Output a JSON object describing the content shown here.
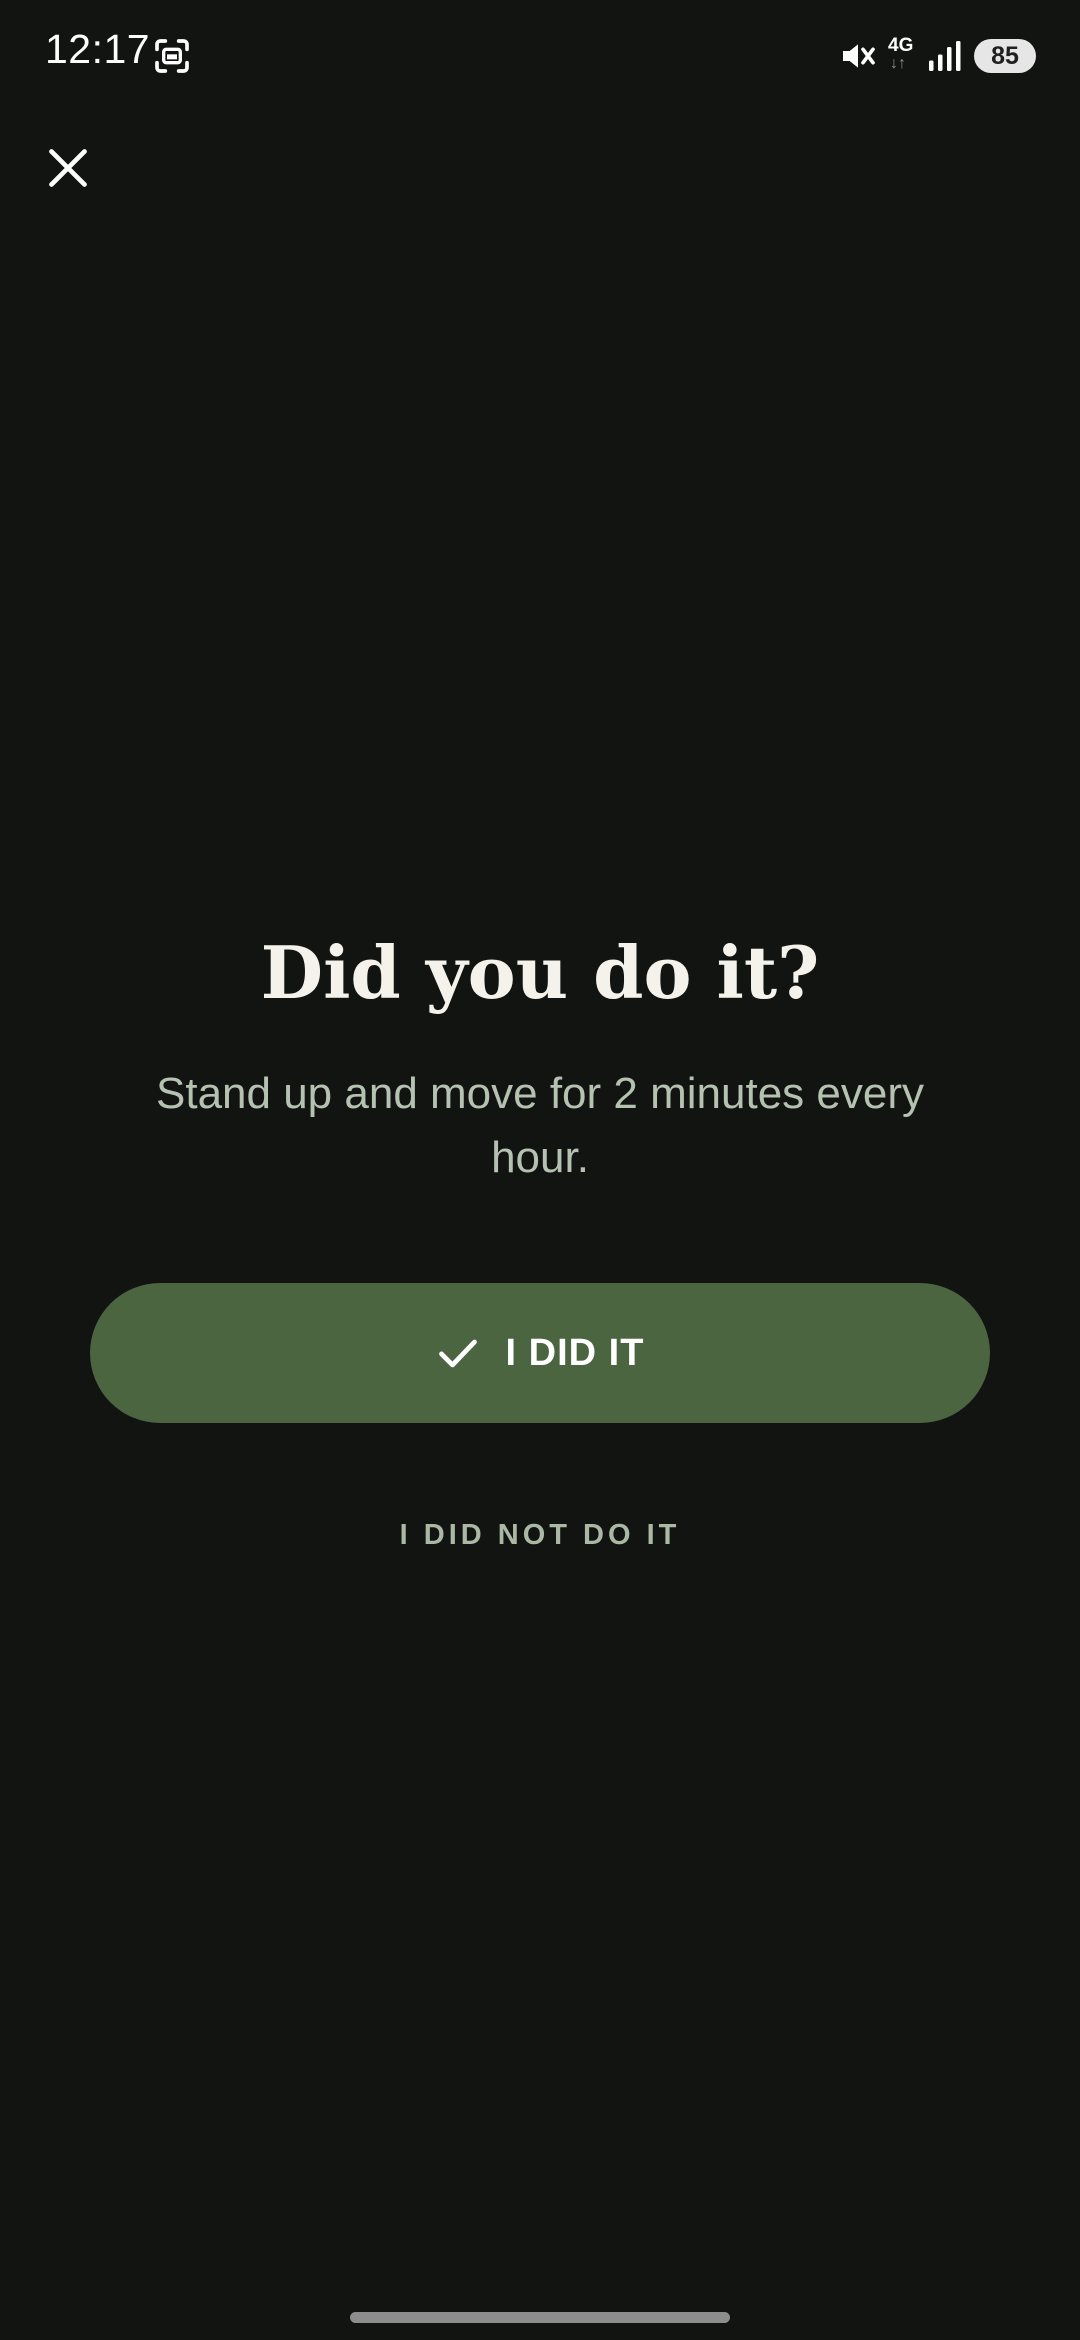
{
  "status_bar": {
    "time": "12:17",
    "network": "4G",
    "network_arrows": "↓↑",
    "battery": "85",
    "icons": [
      "screenshot-icon",
      "mute-icon",
      "signal-icon"
    ]
  },
  "close": {
    "icon": "close-icon"
  },
  "prompt": {
    "title": "Did you do it?",
    "description": "Stand up and move for 2 minutes every hour."
  },
  "actions": {
    "did_it": {
      "label": "I DID IT",
      "icon": "check-icon"
    },
    "did_not": {
      "label": "I DID NOT DO IT"
    }
  },
  "colors": {
    "background": "#121412",
    "primary_button": "#4a6540",
    "secondary_text": "#b5c2b1"
  }
}
